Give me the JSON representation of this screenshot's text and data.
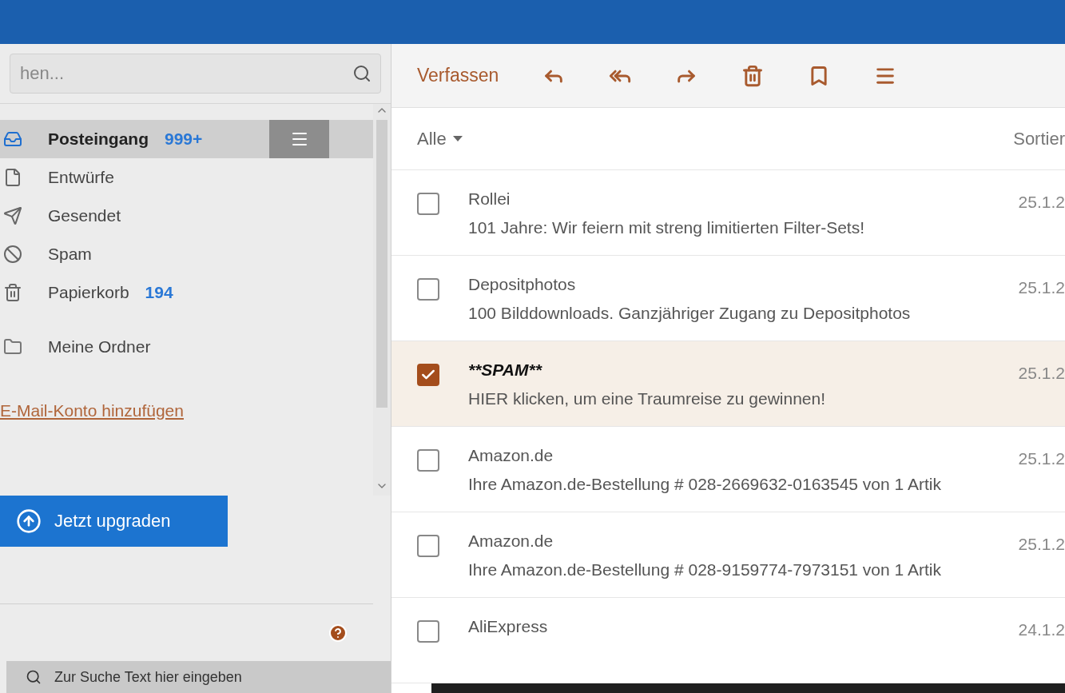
{
  "search": {
    "placeholder": "hen..."
  },
  "folders": [
    {
      "label": "Posteingang",
      "count": "999+",
      "selected": true
    },
    {
      "label": "Entwürfe",
      "selected": false
    },
    {
      "label": "Gesendet",
      "selected": false
    },
    {
      "label": "Spam",
      "selected": false
    },
    {
      "label": "Papierkorb",
      "count": "194",
      "selected": false
    }
  ],
  "my_folders": {
    "label": "Meine Ordner"
  },
  "add_account_link": "E-Mail-Konto hinzufügen",
  "upgrade_button": "Jetzt upgraden",
  "toolbar": {
    "compose": "Verfassen"
  },
  "list_header": {
    "filter": "Alle",
    "sort": "Sortier"
  },
  "messages": [
    {
      "kind": "normal",
      "sender": "Rollei",
      "subject": "101 Jahre: Wir feiern mit streng limitierten Filter-Sets!",
      "date": "25.1.2",
      "checked": false,
      "selected": false
    },
    {
      "kind": "normal",
      "sender": "Depositphotos",
      "subject": "100 Bilddownloads. Ganzjähriger Zugang zu Depositphotos",
      "date": "25.1.2",
      "checked": false,
      "selected": false
    },
    {
      "kind": "spam",
      "sender": "**SPAM**",
      "subject": "HIER klicken, um eine Traumreise zu gewinnen!",
      "date": "25.1.2",
      "checked": true,
      "selected": true
    },
    {
      "kind": "normal",
      "sender": "Amazon.de",
      "subject": "Ihre Amazon.de-Bestellung # 028-2669632-0163545 von 1 Artik",
      "date": "25.1.2",
      "checked": false,
      "selected": false
    },
    {
      "kind": "normal",
      "sender": "Amazon.de",
      "subject": "Ihre Amazon.de-Bestellung # 028-9159774-7973151 von 1 Artik",
      "date": "25.1.2",
      "checked": false,
      "selected": false
    },
    {
      "kind": "normal",
      "sender": "AliExpress",
      "date": "24.1.2",
      "checked": false,
      "selected": false
    }
  ],
  "taskbar": {
    "search_placeholder": "Zur Suche Text hier eingeben"
  }
}
